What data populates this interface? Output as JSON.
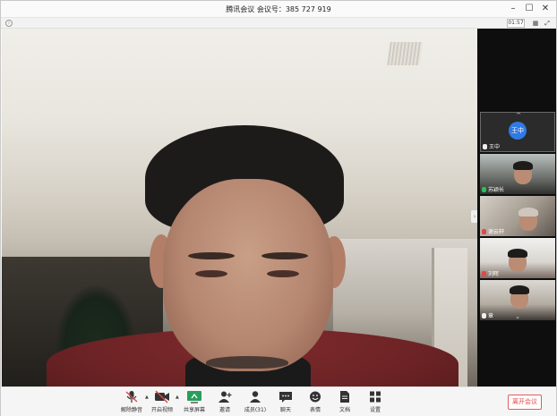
{
  "window": {
    "title": "腾讯会议  会议号：385 727 919",
    "controls": [
      "minimize-icon",
      "maximize-icon",
      "close-icon"
    ]
  },
  "subbar": {
    "timer": "01:57",
    "icons": [
      "info-icon",
      "grid-layout-icon",
      "fullscreen-icon"
    ]
  },
  "participants": {
    "scroll_up": "^",
    "scroll_down": "⌄",
    "items": [
      {
        "name": "王中",
        "avatar_text": "王中",
        "mic": "muted-white",
        "type": "avatar"
      },
      {
        "name": "苏颖长",
        "mic": "green",
        "type": "video"
      },
      {
        "name": "谢云轩",
        "mic": "red",
        "type": "video"
      },
      {
        "name": "刘晖",
        "mic": "red",
        "type": "video"
      },
      {
        "name": "章",
        "mic": "white",
        "type": "video"
      }
    ],
    "accent_color": "#2f7ae5"
  },
  "toolbar": {
    "unmute_label": "解除静音",
    "start_video_label": "开启视频",
    "share_screen_label": "共享屏幕",
    "invite_label": "邀请",
    "members_label": "成员(31)",
    "chat_label": "聊天",
    "reactions_label": "表情",
    "docs_label": "文档",
    "settings_label": "设置",
    "leave_label": "离开会议",
    "leave_color": "#e04a4a"
  }
}
